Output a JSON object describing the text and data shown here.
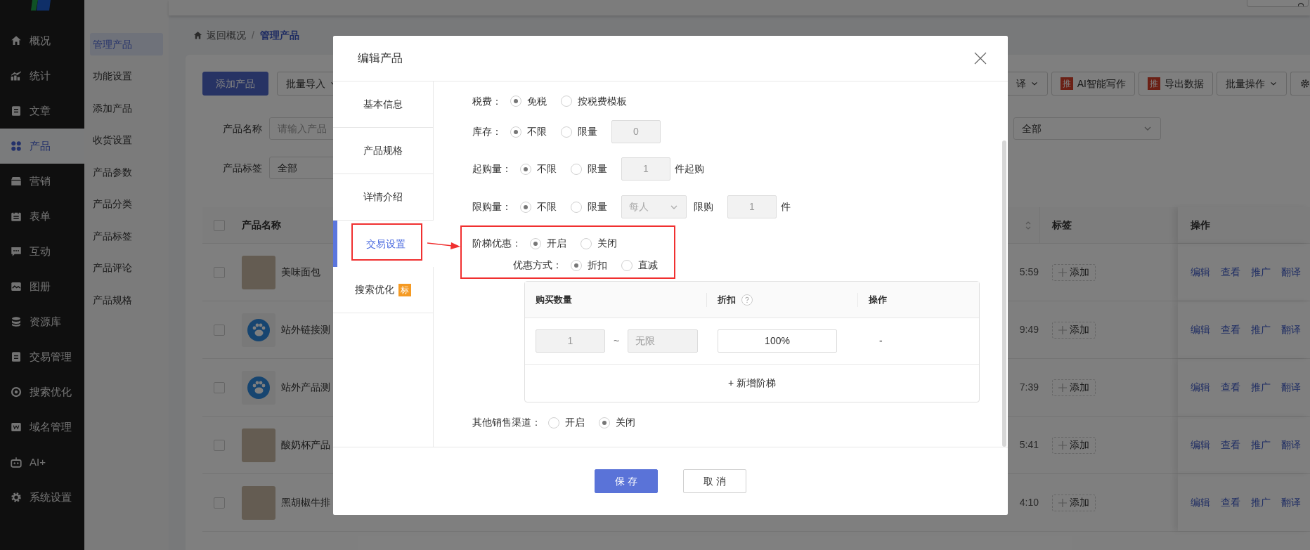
{
  "sidebar": {
    "items": [
      {
        "label": "概况",
        "selected": false
      },
      {
        "label": "统计",
        "selected": false
      },
      {
        "label": "文章",
        "selected": false
      },
      {
        "label": "产品",
        "selected": true
      },
      {
        "label": "营销",
        "selected": false
      },
      {
        "label": "表单",
        "selected": false
      },
      {
        "label": "互动",
        "selected": false
      },
      {
        "label": "图册",
        "selected": false
      },
      {
        "label": "资源库",
        "selected": false
      },
      {
        "label": "交易管理",
        "selected": false
      },
      {
        "label": "搜索优化",
        "selected": false
      },
      {
        "label": "域名管理",
        "selected": false
      },
      {
        "label": "AI+",
        "selected": false
      },
      {
        "label": "系统设置",
        "selected": false
      }
    ]
  },
  "sub_sidebar": {
    "items": [
      {
        "label": "管理产品",
        "selected": true
      },
      {
        "label": "功能设置",
        "selected": false
      },
      {
        "label": "添加产品",
        "selected": false
      },
      {
        "label": "收货设置",
        "selected": false
      },
      {
        "label": "产品参数",
        "selected": false
      },
      {
        "label": "产品分类",
        "selected": false
      },
      {
        "label": "产品标签",
        "selected": false
      },
      {
        "label": "产品评论",
        "selected": false
      },
      {
        "label": "产品规格",
        "selected": false
      }
    ]
  },
  "breadcrumb": [
    {
      "label": "返回概况",
      "current": false
    },
    {
      "label": "管理产品",
      "current": true
    }
  ],
  "breadcrumb_separator": "/",
  "toolbar": {
    "left": [
      {
        "kind": "primary",
        "label": "添加产品"
      },
      {
        "kind": "dropdown",
        "label": "批量导入"
      }
    ],
    "right": [
      {
        "kind": "dropdown",
        "label": "译"
      },
      {
        "kind": "promo",
        "badge": "推",
        "label": "AI智能写作"
      },
      {
        "kind": "promo",
        "badge": "推",
        "label": "导出数据"
      },
      {
        "kind": "dropdown",
        "label": "批量操作"
      },
      {
        "kind": "settings"
      }
    ]
  },
  "filters": {
    "name": {
      "label": "产品名称",
      "placeholder": "请输入产品"
    },
    "tag": {
      "label": "产品标签",
      "value": "全部"
    },
    "select_3": {
      "value": "全部"
    }
  },
  "table": {
    "all_checked": false,
    "columns": {
      "name": "产品名称",
      "tag": "标签",
      "action": "操作"
    },
    "rows": [
      {
        "checked": false,
        "kind": "photo",
        "name": "美味面包",
        "time": "5:59",
        "tag_button": "添加",
        "actions": [
          "编辑",
          "查看",
          "推广",
          "翻译"
        ]
      },
      {
        "checked": false,
        "kind": "paw",
        "name": "站外链接测",
        "time": "9:49",
        "tag_button": "添加",
        "actions": [
          "编辑",
          "查看",
          "推广",
          "翻译"
        ]
      },
      {
        "checked": false,
        "kind": "paw",
        "name": "站外产品测",
        "time": "7:39",
        "tag_button": "添加",
        "actions": [
          "编辑",
          "查看",
          "推广",
          "翻译"
        ]
      },
      {
        "checked": false,
        "kind": "photo",
        "name": "酸奶杯产品",
        "time": "5:41",
        "tag_button": "添加",
        "actions": [
          "编辑",
          "查看",
          "推广",
          "翻译"
        ]
      },
      {
        "checked": false,
        "kind": "photo",
        "name": "黑胡椒牛排",
        "time": "4:10",
        "tag_button": "添加",
        "actions": [
          "编辑",
          "查看",
          "推广",
          "翻译"
        ]
      }
    ]
  },
  "modal": {
    "title": "编辑产品",
    "tabs": [
      {
        "label": "基本信息",
        "selected": false
      },
      {
        "label": "产品规格",
        "selected": false
      },
      {
        "label": "详情介绍",
        "selected": false
      },
      {
        "label": "交易设置",
        "selected": true
      },
      {
        "label": "搜索优化",
        "selected": false,
        "badge": "标"
      }
    ],
    "rows": [
      {
        "label": "税费：",
        "options": [
          {
            "label": "免税",
            "selected": true
          },
          {
            "label": "按税费模板",
            "selected": false
          }
        ],
        "extras": []
      },
      {
        "label": "库存：",
        "options": [
          {
            "label": "不限",
            "selected": true
          },
          {
            "label": "限量",
            "selected": false
          }
        ],
        "extras": [
          {
            "kind": "input",
            "value": "0",
            "disabled": true
          }
        ]
      },
      {
        "label": "起购量：",
        "options": [
          {
            "label": "不限",
            "selected": true
          },
          {
            "label": "限量",
            "selected": false
          }
        ],
        "extras": [
          {
            "kind": "input",
            "value": "1",
            "disabled": true
          },
          {
            "kind": "text",
            "text": "件起购"
          }
        ]
      },
      {
        "label": "限购量：",
        "options": [
          {
            "label": "不限",
            "selected": true
          },
          {
            "label": "限量",
            "selected": false
          }
        ],
        "extras": [
          {
            "kind": "select",
            "value": "每人",
            "disabled": true
          },
          {
            "kind": "text",
            "text": "限购"
          },
          {
            "kind": "input",
            "value": "1",
            "disabled": true
          },
          {
            "kind": "text",
            "text": "件"
          }
        ]
      }
    ],
    "ladder": {
      "label": "阶梯优惠：",
      "options": [
        {
          "label": "开启",
          "selected": true
        },
        {
          "label": "关闭",
          "selected": false
        }
      ],
      "mode": {
        "label": "优惠方式：",
        "options": [
          {
            "label": "折扣",
            "selected": true
          },
          {
            "label": "直减",
            "selected": false
          }
        ]
      },
      "table": {
        "columns": [
          {
            "label": "购买数量"
          },
          {
            "label": "折扣",
            "help": true
          },
          {
            "label": "操作"
          }
        ],
        "rows": [
          {
            "from": "1",
            "separator": "~",
            "to": "无限",
            "discount": "100%",
            "action": "-"
          }
        ],
        "add_label": "+ 新增阶梯"
      }
    },
    "other": {
      "label": "其他销售渠道：",
      "options": [
        {
          "label": "开启",
          "selected": false
        },
        {
          "label": "关闭",
          "selected": true
        }
      ]
    },
    "buttons": [
      {
        "kind": "primary",
        "label": "保 存"
      },
      {
        "kind": "default",
        "label": "取 消"
      }
    ]
  }
}
